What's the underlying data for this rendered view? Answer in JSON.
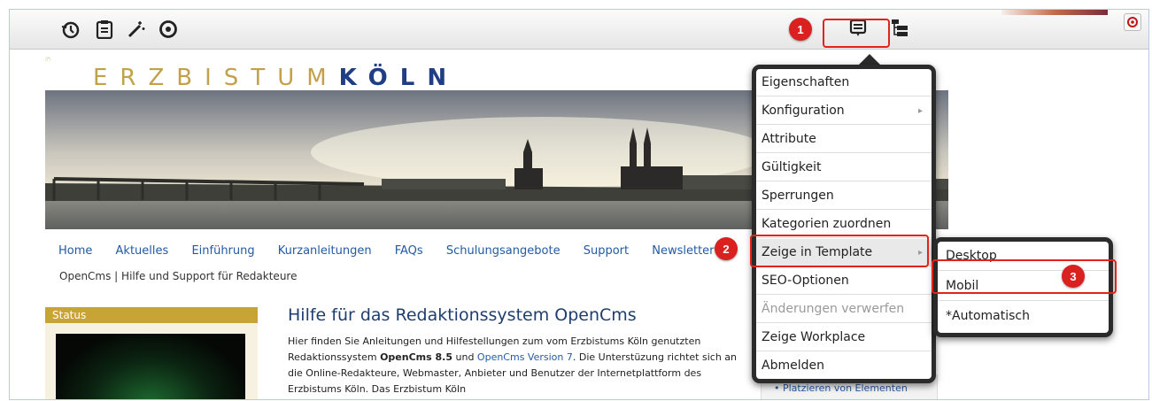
{
  "toolbar": {
    "icons": [
      "history-icon",
      "clipboard-icon",
      "magic-wand-icon",
      "target-icon"
    ],
    "context_icon": "context-menu-icon",
    "sitemap_icon": "sitemap-icon",
    "power_icon": "power-icon"
  },
  "badges": [
    "1",
    "2",
    "3"
  ],
  "site": {
    "logo_plain": "ERZBISTUM",
    "logo_bold": "KÖLN",
    "nav": [
      "Home",
      "Aktuelles",
      "Einführung",
      "Kurzanleitungen",
      "FAQs",
      "Schulungsangebote",
      "Support",
      "Newsletter"
    ],
    "breadcrumb": "OpenCms | Hilfe und Support für Redakteure",
    "status_title": "Status",
    "headline": "Hilfe für das Redaktionssystem OpenCms",
    "para": {
      "p1": "Hier finden Sie Anleitungen und Hilfestellungen zum vom Erzbistums Köln genutzten Redaktionssystem ",
      "b1": "OpenCms 8.5",
      "p2": " und ",
      "link1": "OpenCms Version 7",
      "p3": ". Die Unterstüzung richtet sich an die Online-Redakteure, Webmaster, Anbieter und Benutzer der Internetplattform des Erzbistums Köln.  Das Erzbistum Köln"
    },
    "right_link": "• Platzieren von Elementen"
  },
  "menu": {
    "items": [
      {
        "label": "Eigenschaften",
        "submenu": false,
        "disabled": false
      },
      {
        "label": "Konfiguration",
        "submenu": true,
        "disabled": false
      },
      {
        "label": "Attribute",
        "submenu": false,
        "disabled": false
      },
      {
        "label": "Gültigkeit",
        "submenu": false,
        "disabled": false
      },
      {
        "label": "Sperrungen",
        "submenu": false,
        "disabled": false
      },
      {
        "label": "Kategorien zuordnen",
        "submenu": false,
        "disabled": false
      },
      {
        "label": "Zeige in Template",
        "submenu": true,
        "disabled": false
      },
      {
        "label": "SEO-Optionen",
        "submenu": false,
        "disabled": false
      },
      {
        "label": "Änderungen verwerfen",
        "submenu": false,
        "disabled": true
      },
      {
        "label": "Zeige Workplace",
        "submenu": false,
        "disabled": false
      },
      {
        "label": "Abmelden",
        "submenu": false,
        "disabled": false
      }
    ],
    "submenu_items": [
      "Desktop",
      "Mobil",
      "*Automatisch"
    ]
  },
  "colors": {
    "accent_red": "#e2231a",
    "link_blue": "#245aa3",
    "logo_gold": "#c2a14a",
    "logo_blue": "#1f3e83"
  }
}
